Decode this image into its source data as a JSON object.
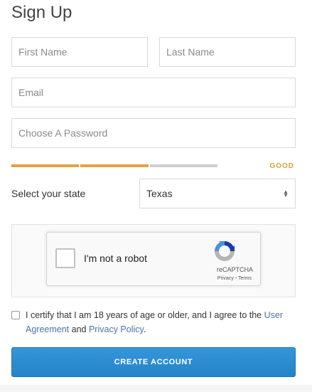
{
  "form": {
    "title": "Sign Up",
    "first_name": {
      "placeholder": "First Name",
      "value": ""
    },
    "last_name": {
      "placeholder": "Last Name",
      "value": ""
    },
    "email": {
      "placeholder": "Email",
      "value": ""
    },
    "password": {
      "placeholder": "Choose A Password",
      "value": ""
    },
    "password_strength": {
      "label": "GOOD",
      "segments_filled": 2,
      "segments_total": 3,
      "color": "#e0a43f"
    },
    "state": {
      "label": "Select your state",
      "selected": "Texas"
    },
    "captcha": {
      "text": "I'm not a robot",
      "brand": "reCAPTCHA",
      "privacy": "Privacy",
      "separator": " - ",
      "terms": "Terms",
      "checked": false
    },
    "certify": {
      "checked": false,
      "text_before": "I certify that I am 18 years of age or older, and I agree to the ",
      "user_agreement": "User Agreement",
      "text_middle": " and ",
      "privacy_policy": "Privacy Policy",
      "text_after": "."
    },
    "submit_label": "CREATE ACCOUNT",
    "colors": {
      "accent": "#2a88cc",
      "link": "#4b74a6",
      "strength": "#d9a236"
    }
  }
}
